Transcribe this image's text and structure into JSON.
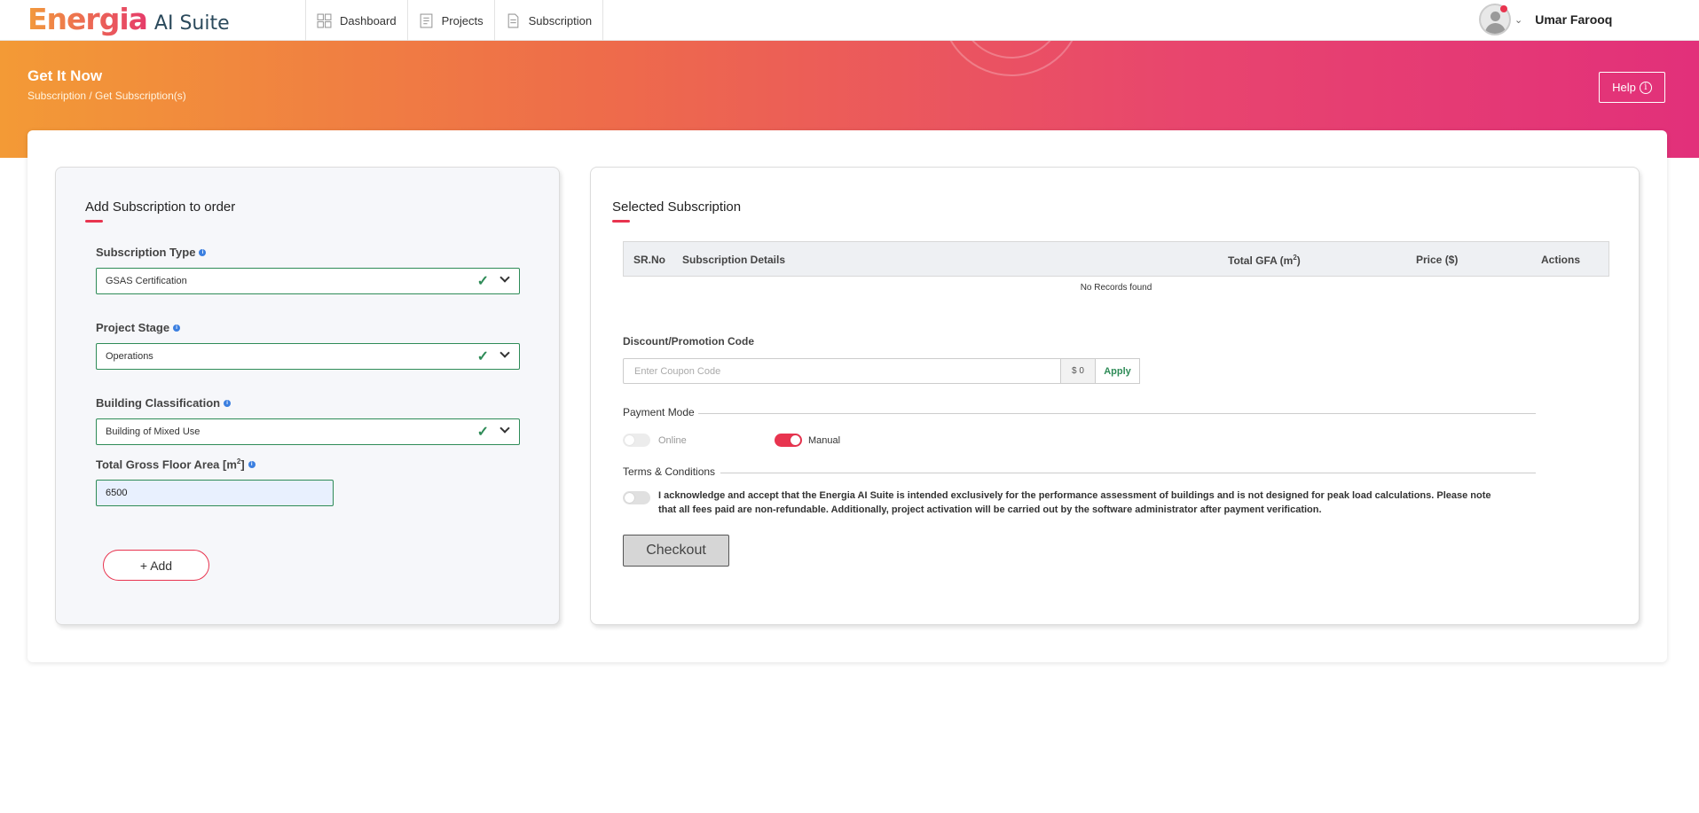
{
  "app": {
    "logo_main": "Energia",
    "logo_sub": "AI Suite"
  },
  "nav": {
    "items": [
      {
        "label": "Dashboard"
      },
      {
        "label": "Projects"
      },
      {
        "label": "Subscription"
      }
    ]
  },
  "user": {
    "name": "Umar Farooq"
  },
  "banner": {
    "title": "Get It Now",
    "breadcrumb": "Subscription / Get Subscription(s)",
    "help_label": "Help"
  },
  "left": {
    "title": "Add Subscription to order",
    "subscription_type": {
      "label": "Subscription Type",
      "value": "GSAS Certification"
    },
    "project_stage": {
      "label": "Project Stage",
      "value": "Operations"
    },
    "building_classification": {
      "label": "Building Classification",
      "value": "Building of Mixed Use"
    },
    "gfa": {
      "label": "Total Gross Floor Area [m",
      "label_sup": "2",
      "label_end": "]",
      "value": "6500"
    },
    "add_label": "Add"
  },
  "right": {
    "title": "Selected Subscription",
    "table": {
      "headers": {
        "srno": "SR.No",
        "details": "Subscription Details",
        "gfa": "Total GFA (m",
        "gfa_sup": "2",
        "gfa_end": ")",
        "price": "Price ($)",
        "actions": "Actions"
      },
      "empty": "No Records found"
    },
    "discount": {
      "label": "Discount/Promotion Code",
      "placeholder": "Enter Coupon Code",
      "amount": "$ 0",
      "apply": "Apply"
    },
    "payment": {
      "label": "Payment Mode",
      "online": "Online",
      "manual": "Manual",
      "online_on": false,
      "manual_on": true
    },
    "terms": {
      "label": "Terms & Conditions",
      "text": "I acknowledge and accept that the Energia AI Suite is intended exclusively for the performance assessment of buildings and is not designed for peak load calculations. Please note that all fees paid are non-refundable. Additionally, project activation will be carried out by the software administrator after payment verification."
    },
    "checkout": "Checkout"
  },
  "colors": {
    "accent": "#e8344f",
    "success": "#2e8b57",
    "banner_start": "#f39a36",
    "banner_end": "#e2307a"
  }
}
